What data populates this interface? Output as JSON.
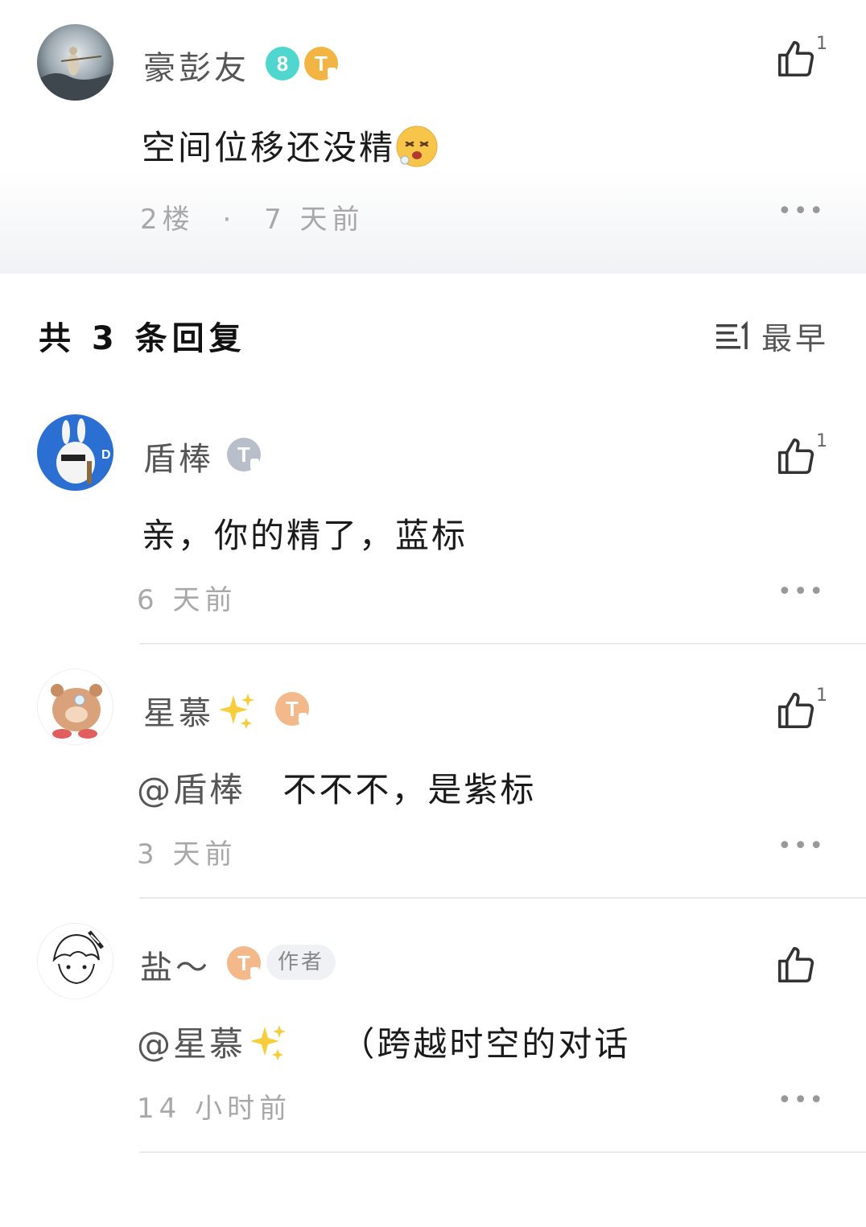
{
  "post": {
    "username": "豪彭友",
    "content": "空间位移还没精",
    "floor": "2楼",
    "dot": "·",
    "time": "7 天前",
    "like_count": "1",
    "badges": {
      "level": "8",
      "tag": "T",
      "tag_sub": "1"
    }
  },
  "replies_header": {
    "title": "共 3 条回复",
    "sort_icon": "list-sort-icon",
    "sort_label": "最早"
  },
  "replies": [
    {
      "username": "盾棒",
      "content": "亲，你的精了，蓝标",
      "time": "6 天前",
      "like_count": "1",
      "badge_tag": "T",
      "badge_sub": "3"
    },
    {
      "username": "星慕",
      "content_mention": "@盾棒",
      "content": "不不不，是紫标",
      "time": "3 天前",
      "like_count": "1",
      "badge_tag": "T",
      "badge_sub": "6"
    },
    {
      "username": "盐～",
      "author_tag": "作者",
      "content_mention": "@星慕",
      "content": "（跨越时空的对话",
      "time": "14 小时前",
      "badge_tag": "T",
      "badge_sub": "6"
    }
  ],
  "icons": {
    "like": "thumbs-up-icon",
    "more": "more-dots-icon",
    "emoji": "dizzy-face-emoji"
  },
  "colors": {
    "level_badge": "#4fd6cf",
    "gold_badge": "#f2b544",
    "silver_badge": "#b9bfca",
    "peach_badge": "#f3b98a"
  },
  "more_glyph": "•••"
}
